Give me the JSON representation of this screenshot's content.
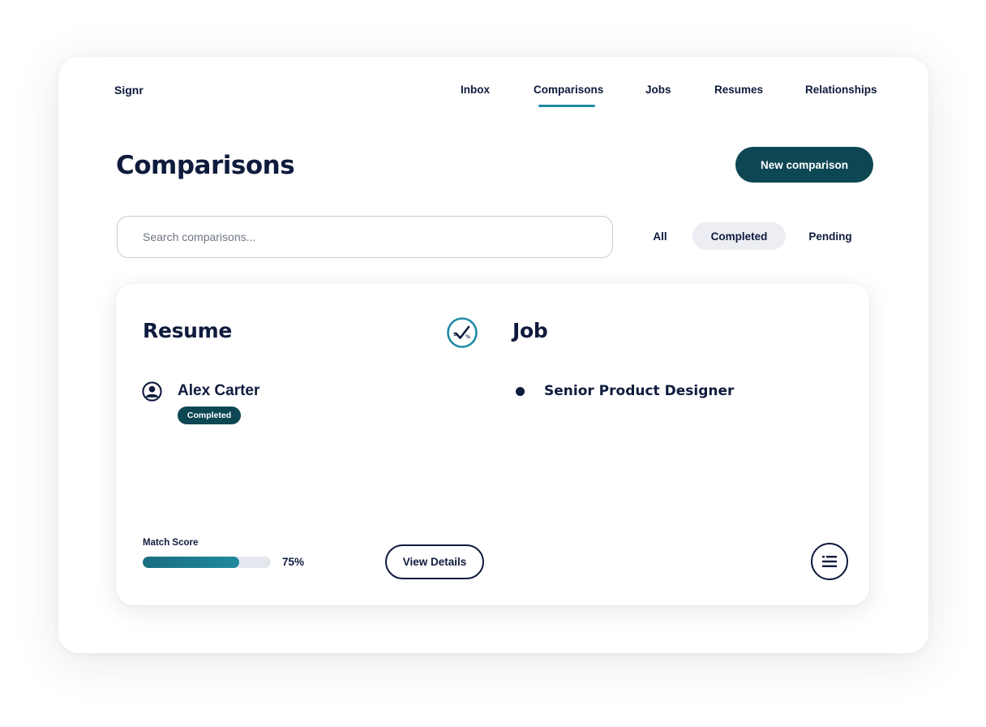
{
  "app": {
    "brand": "Signr"
  },
  "nav": {
    "items": [
      {
        "label": "Inbox"
      },
      {
        "label": "Comparisons",
        "active": true
      },
      {
        "label": "Jobs"
      },
      {
        "label": "Resumes"
      },
      {
        "label": "Relationships"
      }
    ]
  },
  "page": {
    "title": "Comparisons",
    "new_button_label": "New comparison"
  },
  "search": {
    "placeholder": "Search comparisons...",
    "value": ""
  },
  "filters": {
    "selected": "Completed",
    "items": [
      {
        "label": "All"
      },
      {
        "label": "Completed"
      },
      {
        "label": "Pending"
      }
    ]
  },
  "card": {
    "resume_heading": "Resume",
    "job_heading": "Job",
    "match_icon": "check-percent-icon",
    "candidate": {
      "name": "Alex Carter",
      "status": "Completed",
      "icon": "user-icon"
    },
    "job": {
      "title": "Senior Product Designer"
    },
    "match_score": {
      "label": "Match Score",
      "value_text": "75%",
      "fraction": 0.75
    },
    "view_details_label": "View Details",
    "list_icon": "list-icon"
  },
  "colors": {
    "primary": "#0d4753",
    "accent": "#1f8aa6",
    "text": "#0f1b3d",
    "chip_bg": "#eceef4"
  }
}
